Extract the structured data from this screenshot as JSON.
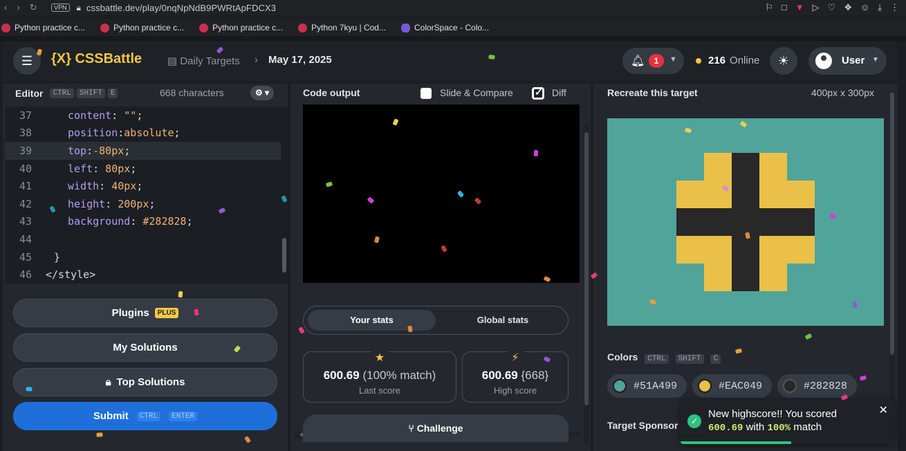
{
  "browser": {
    "url": "cssbattle.dev/play/0nqNpNdB9PWRtApFDCX3",
    "vpn_label": "VPN",
    "bookmarks": [
      "Python practice c...",
      "Python practice c...",
      "Python practice c...",
      "Python 7kyu | Cod...",
      "ColorSpace - Colo..."
    ]
  },
  "header": {
    "logo": "{X} CSSBattle",
    "crumb": "Daily Targets",
    "date": "May 17, 2025",
    "notif_count": "1",
    "online_count": "216",
    "online_label": "Online",
    "user": "User"
  },
  "editor": {
    "title": "Editor",
    "shortcut": [
      "CTRL",
      "SHIFT",
      "E"
    ],
    "chars": "668 characters",
    "lines": [
      {
        "n": "37",
        "html": "content"
      },
      {
        "n": "38"
      },
      {
        "n": "39"
      },
      {
        "n": "40"
      },
      {
        "n": "41"
      },
      {
        "n": "42"
      },
      {
        "n": "43"
      },
      {
        "n": "44"
      },
      {
        "n": "45"
      },
      {
        "n": "46"
      }
    ],
    "buttons": {
      "plugins": "Plugins",
      "plus": "PLUS",
      "my_solutions": "My Solutions",
      "top_solutions": "Top Solutions",
      "submit": "Submit",
      "submit_keys": [
        "CTRL",
        "ENTER"
      ]
    }
  },
  "output": {
    "title": "Code output",
    "slide_compare": "Slide & Compare",
    "diff": "Diff",
    "tab_your": "Your stats",
    "tab_global": "Global stats",
    "last_score": "600.69",
    "last_match": "(100% match)",
    "last_label": "Last score",
    "high_score": "600.69",
    "high_chars": "{668}",
    "high_label": "High score",
    "challenge": "Challenge"
  },
  "target": {
    "title": "Recreate this target",
    "size": "400px x 300px",
    "colors_label": "Colors",
    "colors_keys": [
      "CTRL",
      "SHIFT",
      "C"
    ],
    "colors": [
      "#51A499",
      "#EAC049",
      "#282828"
    ],
    "sponsor": "Target Sponsor"
  },
  "toast": {
    "line1": "New highscore!! You scored",
    "score": "600.69",
    "with": "with",
    "pct": "100%",
    "match": "match"
  }
}
